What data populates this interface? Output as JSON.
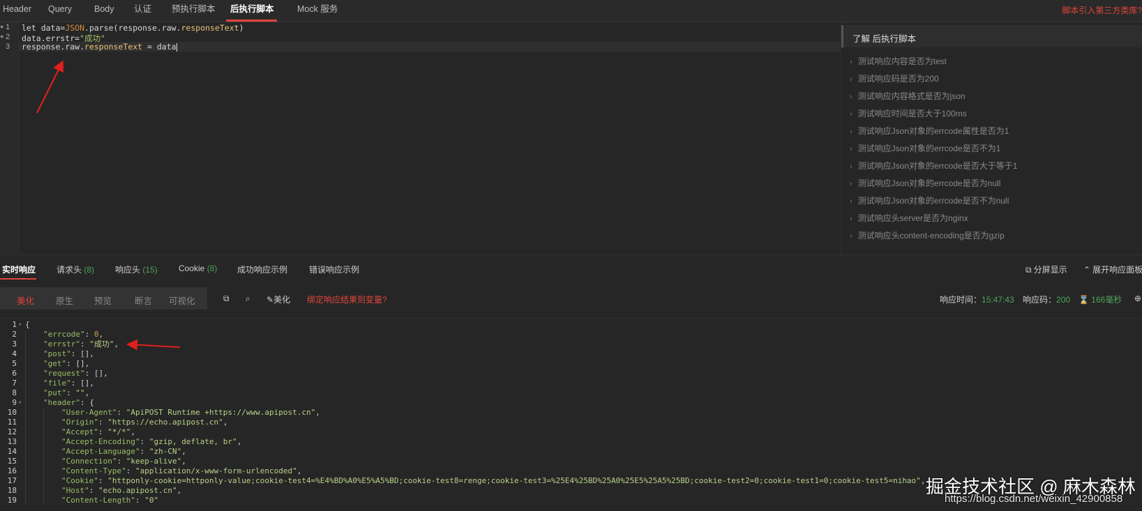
{
  "top_tabs": [
    {
      "label": "Header",
      "active": false
    },
    {
      "label": "Query",
      "active": false
    },
    {
      "label": "Body",
      "active": false
    },
    {
      "label": "认证",
      "active": false
    },
    {
      "label": "预执行脚本",
      "active": false
    },
    {
      "label": "后执行脚本",
      "active": true
    },
    {
      "label": "Mock 服务",
      "active": false
    }
  ],
  "third_party_link": "脚本引入第三方类库?",
  "script_lines": [
    {
      "num": "1"
    },
    {
      "num": "2"
    },
    {
      "num": "3"
    }
  ],
  "script_code": {
    "l1_a": "let data=",
    "l1_obj": "JSON",
    "l1_b": ".parse(response.raw.",
    "l1_prop": "responseText",
    "l1_c": ")",
    "l2_a": "data.errstr=",
    "l2_str": "\"成功\"",
    "l3_a": "response.raw.",
    "l3_prop": "responseText",
    "l3_b": " = data"
  },
  "help_panel": {
    "title": "了解 后执行脚本",
    "items": [
      "测试响应内容是否为test",
      "测试响应码是否为200",
      "测试响应内容格式是否为json",
      "测试响应时间是否大于100ms",
      "测试响应Json对象的errcode属性是否为1",
      "测试响应Json对象的errcode是否不为1",
      "测试响应Json对象的errcode是否大于等于1",
      "测试响应Json对象的errcode是否为null",
      "测试响应Json对象的errcode是否不为null",
      "测试响应头server是否为nginx",
      "测试响应头content-encoding是否为gzip"
    ]
  },
  "response_tabs": {
    "realtime": "实时响应",
    "req_headers": "请求头",
    "req_headers_count": "(8)",
    "resp_headers": "响应头",
    "resp_headers_count": "(15)",
    "cookie": "Cookie",
    "cookie_count": "(8)",
    "success_example": "成功响应示例",
    "error_example": "错误响应示例",
    "split_view": "分屏显示",
    "expand_panel": "展开响应面板"
  },
  "toolbar": {
    "segments": [
      "美化",
      "原生",
      "预览",
      "断言",
      "可视化"
    ],
    "beautify": "美化",
    "bind_var": "绑定响应结果到变量?",
    "resp_time_label": "响应时间：",
    "resp_time": "15:47:43",
    "resp_code_label": "响应码：",
    "resp_code": "200",
    "duration": "166毫秒"
  },
  "response_lines": [
    {
      "n": "1",
      "fold": true,
      "indent": 0,
      "parts": [
        [
          "jp",
          "{"
        ]
      ]
    },
    {
      "n": "2",
      "indent": 1,
      "parts": [
        [
          "jk",
          "\"errcode\""
        ],
        [
          "jp",
          ": "
        ],
        [
          "jn",
          "0"
        ],
        [
          "jp",
          ","
        ]
      ]
    },
    {
      "n": "3",
      "indent": 1,
      "parts": [
        [
          "jk",
          "\"errstr\""
        ],
        [
          "jp",
          ": "
        ],
        [
          "js",
          "\"成功\""
        ],
        [
          "jp",
          ","
        ]
      ]
    },
    {
      "n": "4",
      "indent": 1,
      "parts": [
        [
          "jk",
          "\"post\""
        ],
        [
          "jp",
          ": [],"
        ]
      ]
    },
    {
      "n": "5",
      "indent": 1,
      "parts": [
        [
          "jk",
          "\"get\""
        ],
        [
          "jp",
          ": [],"
        ]
      ]
    },
    {
      "n": "6",
      "indent": 1,
      "parts": [
        [
          "jk",
          "\"request\""
        ],
        [
          "jp",
          ": [],"
        ]
      ]
    },
    {
      "n": "7",
      "indent": 1,
      "parts": [
        [
          "jk",
          "\"file\""
        ],
        [
          "jp",
          ": [],"
        ]
      ]
    },
    {
      "n": "8",
      "indent": 1,
      "parts": [
        [
          "jk",
          "\"put\""
        ],
        [
          "jp",
          ": "
        ],
        [
          "js",
          "\"\""
        ],
        [
          "jp",
          ","
        ]
      ]
    },
    {
      "n": "9",
      "fold": true,
      "indent": 1,
      "parts": [
        [
          "jk",
          "\"header\""
        ],
        [
          "jp",
          ": {"
        ]
      ]
    },
    {
      "n": "10",
      "indent": 2,
      "parts": [
        [
          "jk",
          "\"User-Agent\""
        ],
        [
          "jp",
          ": "
        ],
        [
          "js",
          "\"ApiPOST Runtime +https://www.apipost.cn\""
        ],
        [
          "jp",
          ","
        ]
      ]
    },
    {
      "n": "11",
      "indent": 2,
      "parts": [
        [
          "jk",
          "\"Origin\""
        ],
        [
          "jp",
          ": "
        ],
        [
          "js",
          "\"https://echo.apipost.cn\""
        ],
        [
          "jp",
          ","
        ]
      ]
    },
    {
      "n": "12",
      "indent": 2,
      "parts": [
        [
          "jk",
          "\"Accept\""
        ],
        [
          "jp",
          ": "
        ],
        [
          "js",
          "\"*/*\""
        ],
        [
          "jp",
          ","
        ]
      ]
    },
    {
      "n": "13",
      "indent": 2,
      "parts": [
        [
          "jk",
          "\"Accept-Encoding\""
        ],
        [
          "jp",
          ": "
        ],
        [
          "js",
          "\"gzip, deflate, br\""
        ],
        [
          "jp",
          ","
        ]
      ]
    },
    {
      "n": "14",
      "indent": 2,
      "parts": [
        [
          "jk",
          "\"Accept-Language\""
        ],
        [
          "jp",
          ": "
        ],
        [
          "js",
          "\"zh-CN\""
        ],
        [
          "jp",
          ","
        ]
      ]
    },
    {
      "n": "15",
      "indent": 2,
      "parts": [
        [
          "jk",
          "\"Connection\""
        ],
        [
          "jp",
          ": "
        ],
        [
          "js",
          "\"keep-alive\""
        ],
        [
          "jp",
          ","
        ]
      ]
    },
    {
      "n": "16",
      "indent": 2,
      "parts": [
        [
          "jk",
          "\"Content-Type\""
        ],
        [
          "jp",
          ": "
        ],
        [
          "js",
          "\"application/x-www-form-urlencoded\""
        ],
        [
          "jp",
          ","
        ]
      ]
    },
    {
      "n": "17",
      "indent": 2,
      "parts": [
        [
          "jk",
          "\"Cookie\""
        ],
        [
          "jp",
          ": "
        ],
        [
          "js",
          "\"httponly-cookie=httponly-value;cookie-test4=%E4%BD%A0%E5%A5%BD;cookie-test8=renge;cookie-test3=%25E4%25BD%25A0%25E5%25A5%25BD;cookie-test2=0;cookie-test1=0;cookie-test5=nihao\""
        ],
        [
          "jp",
          ","
        ]
      ]
    },
    {
      "n": "18",
      "indent": 2,
      "parts": [
        [
          "jk",
          "\"Host\""
        ],
        [
          "jp",
          ": "
        ],
        [
          "js",
          "\"echo.apipost.cn\""
        ],
        [
          "jp",
          ","
        ]
      ]
    },
    {
      "n": "19",
      "indent": 2,
      "parts": [
        [
          "jk",
          "\"Content-Length\""
        ],
        [
          "jp",
          ": "
        ],
        [
          "js",
          "\"0\""
        ]
      ]
    }
  ],
  "watermark": {
    "text": "掘金技术社区 @ 麻木森林",
    "url": "https://blog.csdn.net/weixin_42900858"
  },
  "colors": {
    "accent": "#e0453b",
    "count_green": "#4ea35a",
    "annotation_arrow": "#e0201c"
  }
}
